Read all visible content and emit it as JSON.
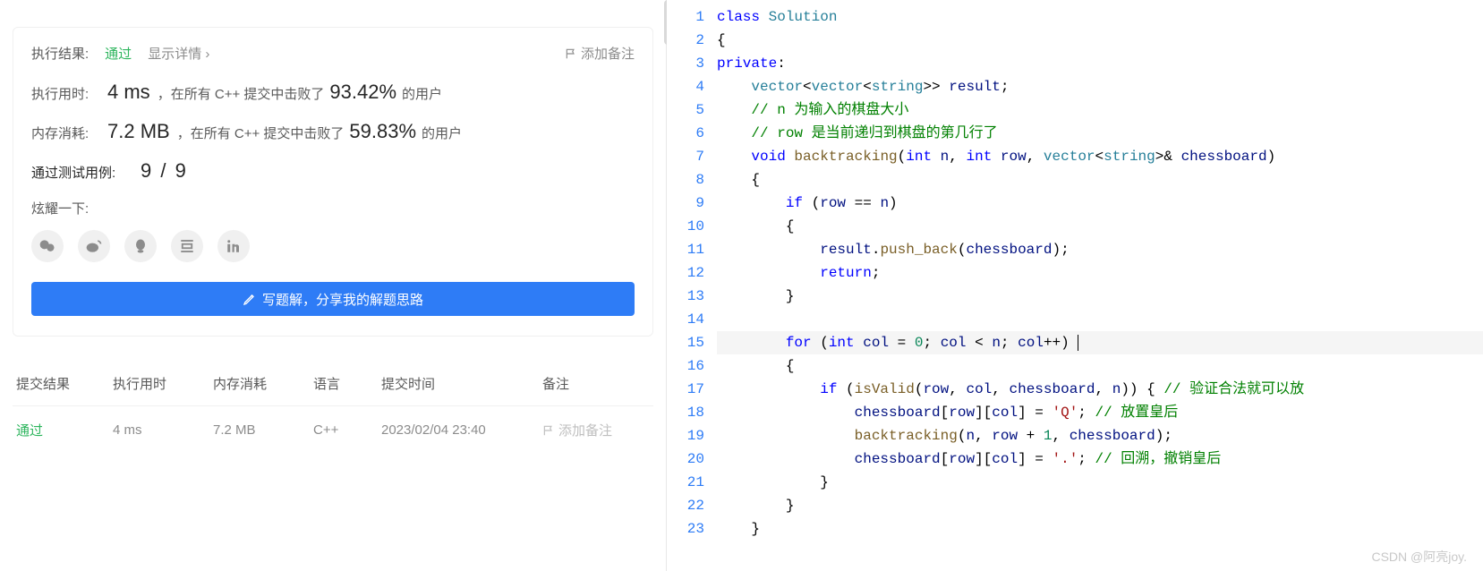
{
  "result": {
    "label": "执行结果:",
    "status": "通过",
    "detail_link": "显示详情 ›",
    "add_note": "添加备注"
  },
  "runtime": {
    "label": "执行用时:",
    "value": "4 ms",
    "prefix": "，在所有 C++ 提交中击败了",
    "pct": "93.42%",
    "suffix": "的用户"
  },
  "memory": {
    "label": "内存消耗:",
    "value": "7.2 MB",
    "prefix": "，在所有 C++ 提交中击败了",
    "pct": "59.83%",
    "suffix": "的用户"
  },
  "testcases": {
    "label": "通过测试用例:",
    "value": "9 / 9"
  },
  "share": {
    "label": "炫耀一下:"
  },
  "write_button": "写题解，分享我的解题思路",
  "table": {
    "headers": {
      "result": "提交结果",
      "time": "执行用时",
      "mem": "内存消耗",
      "lang": "语言",
      "date": "提交时间",
      "note": "备注"
    },
    "row": {
      "result": "通过",
      "time": "4 ms",
      "mem": "7.2 MB",
      "lang": "C++",
      "date": "2023/02/04 23:40",
      "note": "添加备注"
    }
  },
  "code": {
    "lines": [
      {
        "n": 1,
        "html": "<span class='kw'>class</span> <span class='cls'>Solution</span>"
      },
      {
        "n": 2,
        "html": "{"
      },
      {
        "n": 3,
        "html": "<span class='kw'>private</span>:"
      },
      {
        "n": 4,
        "html": "    <span class='type'>vector</span>&lt;<span class='type'>vector</span>&lt;<span class='type'>string</span>&gt;&gt; <span class='var'>result</span>;"
      },
      {
        "n": 5,
        "html": "    <span class='cmt'>// n 为输入的棋盘大小</span>"
      },
      {
        "n": 6,
        "html": "    <span class='cmt'>// row 是当前递归到棋盘的第几行了</span>"
      },
      {
        "n": 7,
        "html": "    <span class='kw'>void</span> <span class='fn'>backtracking</span>(<span class='kw'>int</span> <span class='var'>n</span>, <span class='kw'>int</span> <span class='var'>row</span>, <span class='type'>vector</span>&lt;<span class='type'>string</span>&gt;&amp; <span class='var'>chessboard</span>)"
      },
      {
        "n": 8,
        "html": "    {"
      },
      {
        "n": 9,
        "html": "        <span class='kw'>if</span> (<span class='var'>row</span> == <span class='var'>n</span>)"
      },
      {
        "n": 10,
        "html": "        {"
      },
      {
        "n": 11,
        "html": "            <span class='var'>result</span>.<span class='fn'>push_back</span>(<span class='var'>chessboard</span>);"
      },
      {
        "n": 12,
        "html": "            <span class='kw'>return</span>;"
      },
      {
        "n": 13,
        "html": "        }"
      },
      {
        "n": 14,
        "html": ""
      },
      {
        "n": 15,
        "hl": true,
        "html": "        <span class='kw'>for</span> (<span class='kw'>int</span> <span class='var'>col</span> = <span class='num'>0</span>; <span class='var'>col</span> &lt; <span class='var'>n</span>; <span class='var'>col</span>++) <span class='cursor'></span>"
      },
      {
        "n": 16,
        "html": "        {"
      },
      {
        "n": 17,
        "html": "            <span class='kw'>if</span> (<span class='fn'>isValid</span>(<span class='var'>row</span>, <span class='var'>col</span>, <span class='var'>chessboard</span>, <span class='var'>n</span>)) { <span class='cmt'>// 验证合法就可以放</span>"
      },
      {
        "n": 18,
        "html": "                <span class='var'>chessboard</span>[<span class='var'>row</span>][<span class='var'>col</span>] = <span class='str'>'Q'</span>; <span class='cmt'>// 放置皇后</span>"
      },
      {
        "n": 19,
        "html": "                <span class='fn'>backtracking</span>(<span class='var'>n</span>, <span class='var'>row</span> + <span class='num'>1</span>, <span class='var'>chessboard</span>);"
      },
      {
        "n": 20,
        "html": "                <span class='var'>chessboard</span>[<span class='var'>row</span>][<span class='var'>col</span>] = <span class='str'>'.'</span>; <span class='cmt'>// 回溯，撤销皇后</span>"
      },
      {
        "n": 21,
        "html": "            }"
      },
      {
        "n": 22,
        "html": "        }"
      },
      {
        "n": 23,
        "html": "    }"
      }
    ]
  },
  "watermark": "CSDN @阿亮joy."
}
